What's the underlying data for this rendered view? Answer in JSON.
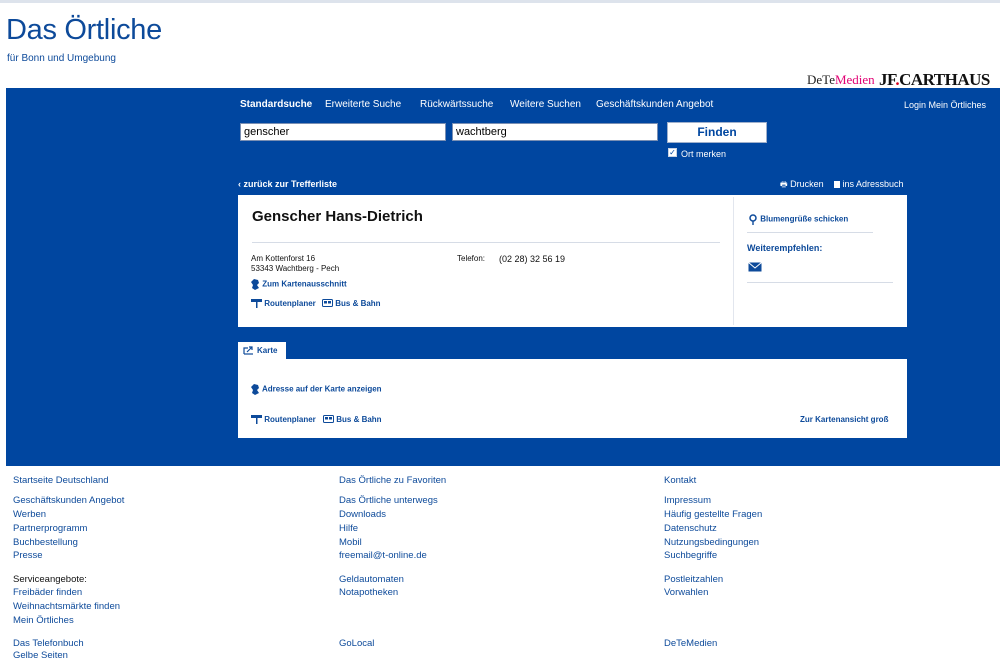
{
  "brand": {
    "logo": "Das Örtliche",
    "tagline": "für Bonn und Umgebung",
    "partner1_a": "DeTe",
    "partner1_b": "Medien",
    "partner2_a": "JF",
    "partner2_b": "CARTHAUS"
  },
  "nav": {
    "items": [
      "Standardsuche",
      "Erweiterte Suche",
      "Rückwärtssuche",
      "Weitere Suchen",
      "Geschäftskunden Angebot"
    ],
    "login": "Login Mein Örtliches"
  },
  "search": {
    "name_value": "genscher",
    "location_value": "wachtberg",
    "find_label": "Finden",
    "remember_label": "Ort merken",
    "remember_checked": "✓"
  },
  "result_bar": {
    "back": "zurück zur Trefferliste",
    "print": "Drucken",
    "addressbook": "ins Adressbuch"
  },
  "entry": {
    "name": "Genscher Hans-Dietrich",
    "street": "Am Kottenforst 16",
    "city": "53343 Wachtberg - Pech",
    "phone_label": "Telefon:",
    "phone": "(02 28) 32 56 19",
    "map_link": "Zum Kartenausschnitt",
    "route": "Routenplaner",
    "bus": "Bus & Bahn",
    "flowers": "Blumengrüße schicken",
    "recommend": "Weiterempfehlen:"
  },
  "map_panel": {
    "tab": "Karte",
    "show_address": "Adresse auf der Karte anzeigen",
    "route": "Routenplaner",
    "bus": "Bus & Bahn",
    "big_view": "Zur Kartenansicht groß"
  },
  "footer": {
    "col1": [
      "Startseite Deutschland",
      "Geschäftskunden Angebot",
      "Werben",
      "Partnerprogramm",
      "Buchbestellung",
      "Presse",
      "Serviceangebote:",
      "Freibäder finden",
      "Weihnachtsmärkte finden",
      "Mein Örtliches",
      "Das Telefonbuch",
      "Gelbe Seiten"
    ],
    "col2": [
      "Das Örtliche zu Favoriten",
      "Das Örtliche unterwegs",
      "Downloads",
      "Hilfe",
      "Mobil",
      "freemail@t-online.de",
      "Geldautomaten",
      "Notapotheken",
      "GoLocal"
    ],
    "col3": [
      "Kontakt",
      "Impressum",
      "Häufig gestellte Fragen",
      "Datenschutz",
      "Nutzungsbedingungen",
      "Suchbegriffe",
      "Postleitzahlen",
      "Vorwahlen",
      "DeTeMedien"
    ]
  },
  "colors": {
    "brand_blue": "#0046a0",
    "link_blue": "#0d4a9a",
    "magenta": "#e20074",
    "carthaus_red": "#d8001c"
  }
}
